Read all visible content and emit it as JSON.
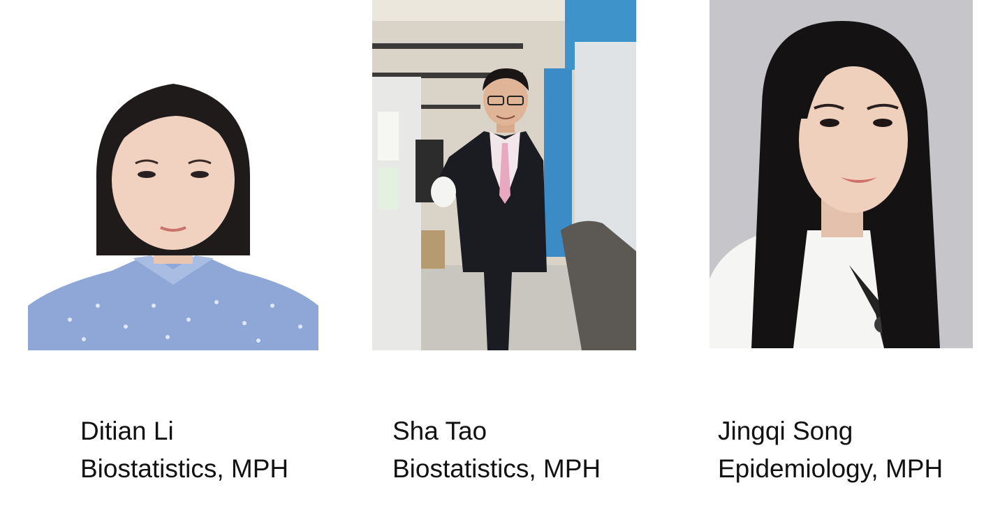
{
  "people": [
    {
      "name": "Ditian Li",
      "program": "Biostatistics, MPH"
    },
    {
      "name": "Sha Tao",
      "program": "Biostatistics, MPH"
    },
    {
      "name": "Jingqi Song",
      "program": "Epidemiology, MPH"
    }
  ]
}
